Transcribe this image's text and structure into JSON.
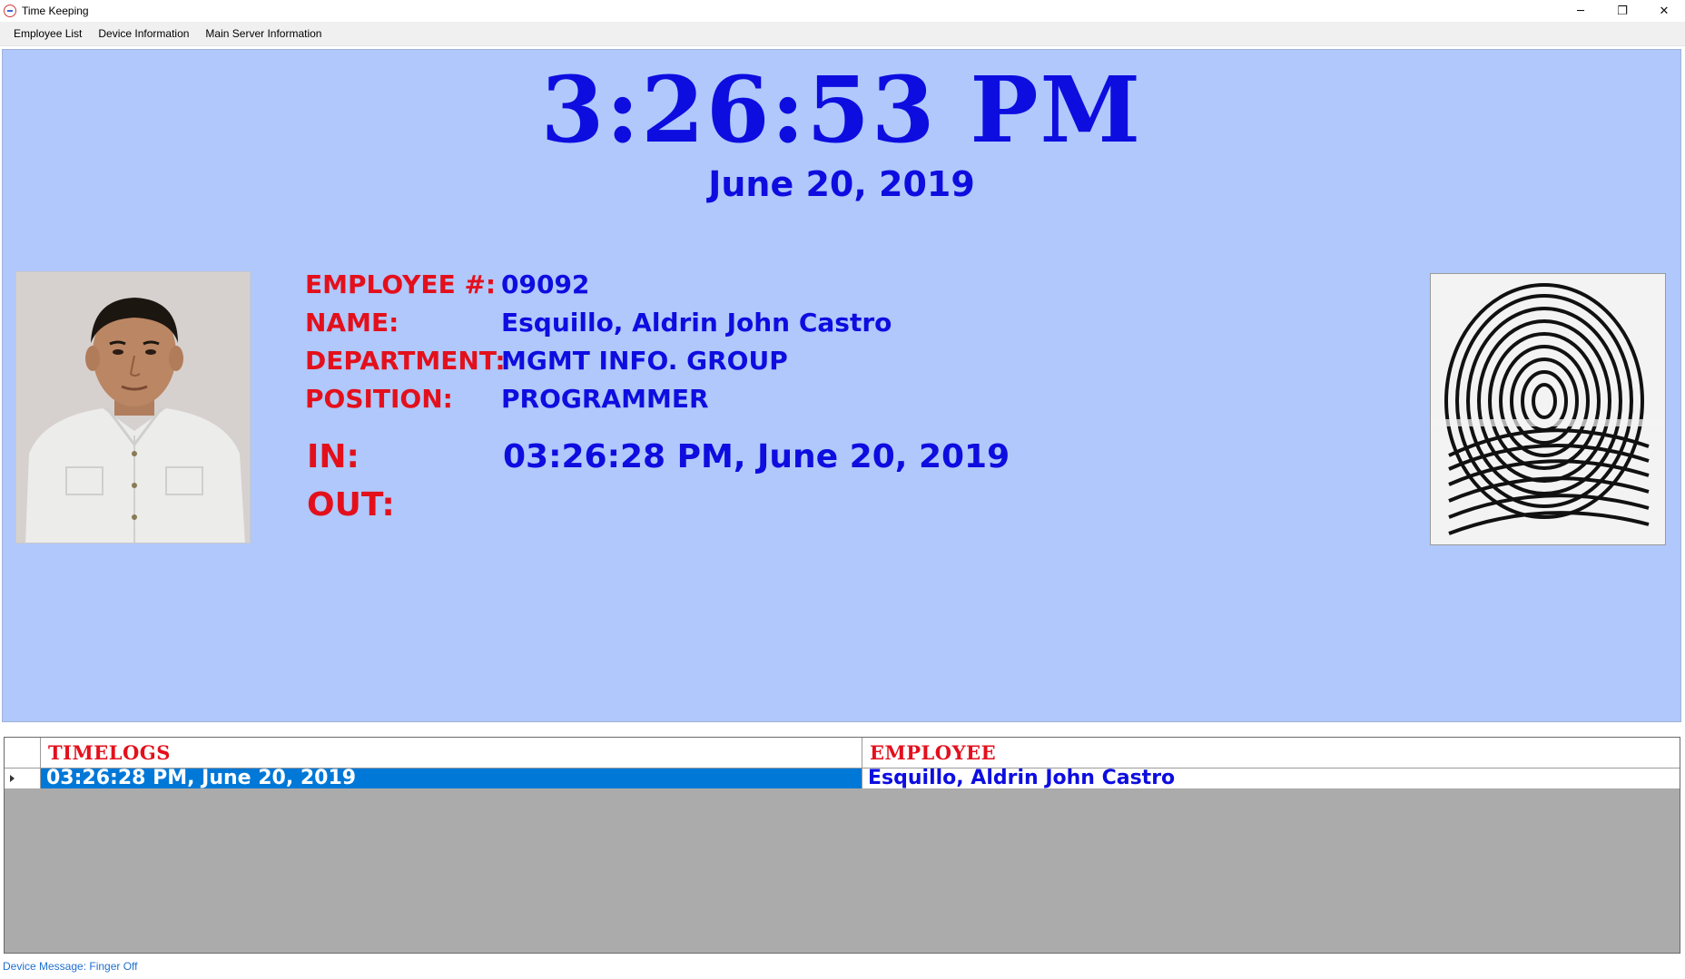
{
  "window": {
    "title": "Time Keeping",
    "controls": {
      "minimize": "─",
      "restore": "❐",
      "close": "✕"
    }
  },
  "menu": {
    "items": [
      "Employee List",
      "Device Information",
      "Main Server Information"
    ]
  },
  "clock": {
    "time": "3:26:53 PM",
    "date": "June 20, 2019"
  },
  "employee": {
    "number_label": "EMPLOYEE #:",
    "number": "09092",
    "name_label": "NAME:",
    "name": "Esquillo, Aldrin John Castro",
    "department_label": "DEPARTMENT:",
    "department": "MGMT INFO. GROUP",
    "position_label": "POSITION:",
    "position": "PROGRAMMER",
    "in_label": "IN:",
    "in_value": "03:26:28 PM, June 20, 2019",
    "out_label": "OUT:",
    "out_value": ""
  },
  "timelogs": {
    "columns": [
      "TIMELOGS",
      "EMPLOYEE"
    ],
    "rows": [
      {
        "timelog": "03:26:28 PM, June 20, 2019",
        "employee": "Esquillo, Aldrin John Castro"
      }
    ]
  },
  "status": {
    "message": "Device Message: Finger Off"
  },
  "colors": {
    "panel_bg": "#b0c8fb",
    "blue_text": "#0d0de0",
    "red_text": "#e3101c",
    "selection": "#0078d7",
    "grid_bg": "#ababab"
  },
  "icons": {
    "app": "clock-app-icon",
    "row_indicator": "row-pointer-icon"
  }
}
